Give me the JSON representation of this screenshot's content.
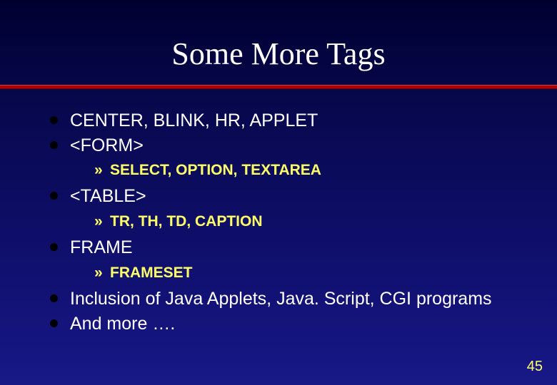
{
  "slide": {
    "title": "Some More Tags",
    "bullets": {
      "b1": "CENTER, BLINK, HR, APPLET",
      "b2": "<FORM>",
      "b2_s1": "SELECT, OPTION, TEXTAREA",
      "b3": "<TABLE>",
      "b3_s1": "TR, TH, TD, CAPTION",
      "b4": "FRAME",
      "b4_s1": "FRAMESET",
      "b5": "Inclusion of Java Applets, Java. Script, CGI programs",
      "b6": "And more …."
    },
    "page_number": "45"
  }
}
